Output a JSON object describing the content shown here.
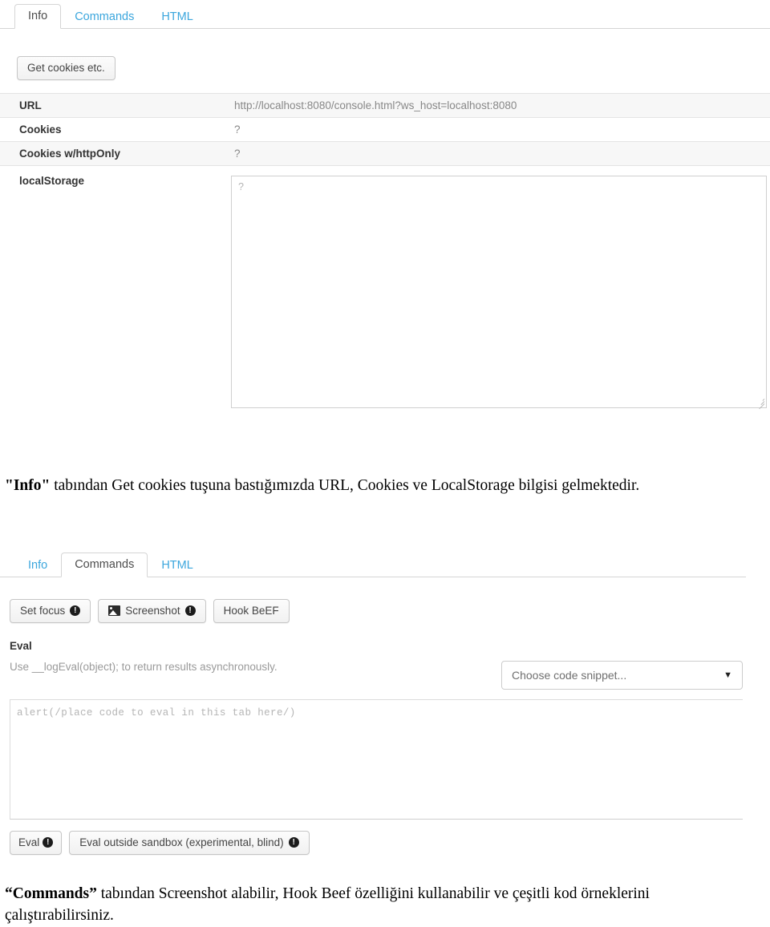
{
  "screenshot_info": {
    "tabs": [
      {
        "label": "Info",
        "active": true
      },
      {
        "label": "Commands",
        "active": false
      },
      {
        "label": "HTML",
        "active": false
      }
    ],
    "get_cookies_button": "Get cookies etc.",
    "rows": [
      {
        "label": "URL",
        "value": "http://localhost:8080/console.html?ws_host=localhost:8080"
      },
      {
        "label": "Cookies",
        "value": "?"
      },
      {
        "label": "Cookies w/httpOnly",
        "value": "?"
      },
      {
        "label": "localStorage",
        "value": "?"
      }
    ]
  },
  "caption_one": {
    "quoted": "\"Info\"",
    "rest": " tabından  Get cookies tuşuna bastığımızda URL, Cookies ve LocalStorage bilgisi gelmektedir."
  },
  "screenshot_commands": {
    "tabs": [
      {
        "label": "Info",
        "active": false
      },
      {
        "label": "Commands",
        "active": true
      },
      {
        "label": "HTML",
        "active": false
      }
    ],
    "buttons": [
      {
        "label": "Set focus",
        "icon": "warning-icon",
        "has_image_icon": false
      },
      {
        "label": "Screenshot",
        "icon": "warning-icon",
        "has_image_icon": true
      },
      {
        "label": "Hook BeEF",
        "icon": "",
        "has_image_icon": false
      }
    ],
    "eval": {
      "heading": "Eval",
      "subtitle": "Use __logEval(object); to return results asynchronously.",
      "snippet_select_value": "Choose code snippet...",
      "caret_glyph": "▼",
      "code_placeholder": "alert(/place code to eval in this tab here/)",
      "eval_button": "Eval",
      "eval_outside_button": "Eval outside sandbox (experimental, blind)",
      "warning_glyph": "!"
    }
  },
  "caption_two": {
    "quoted": "“Commands”",
    "rest": " tabından Screenshot alabilir, Hook Beef özelliğini kullanabilir ve çeşitli kod örneklerini çalıştırabilirsiniz."
  },
  "colors": {
    "tab_link": "#3ba6dd",
    "tab_active_text": "#4d4d4d",
    "row_shade": "#f7f7f7",
    "muted_text": "#9a9a9a",
    "badge": "#1b1b1b"
  }
}
